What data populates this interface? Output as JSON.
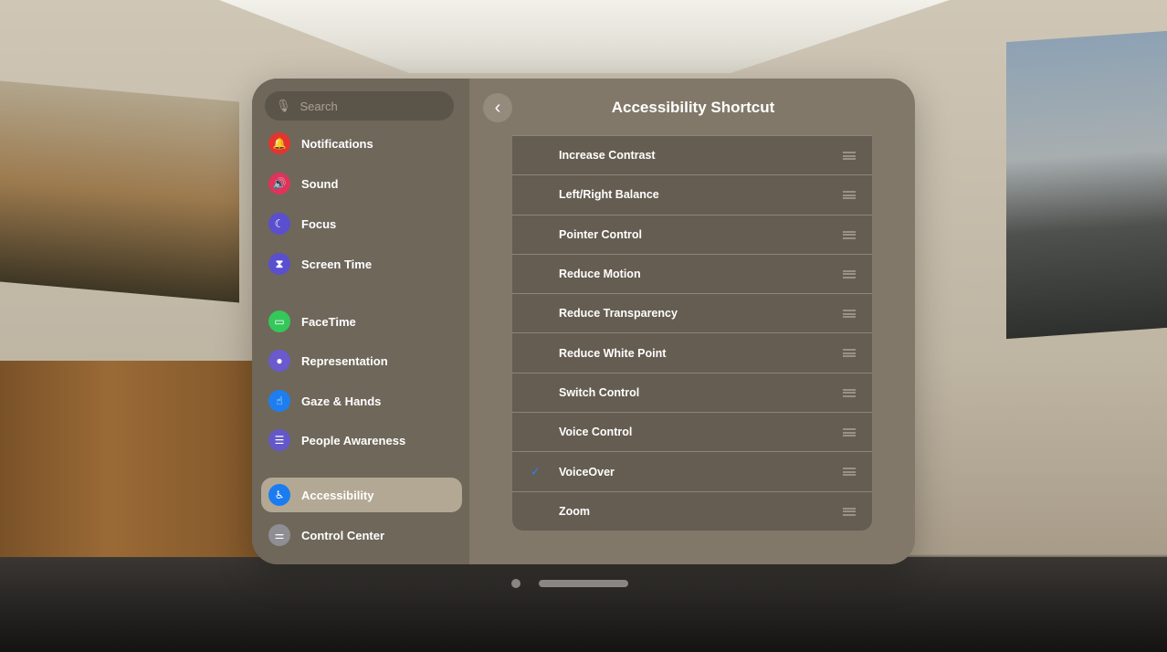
{
  "sidebar": {
    "search_placeholder": "Search",
    "items": [
      {
        "label": "Notifications",
        "icon": "bell-icon",
        "color": "#e5342f"
      },
      {
        "label": "Sound",
        "icon": "speaker-icon",
        "color": "#e0335a"
      },
      {
        "label": "Focus",
        "icon": "moon-icon",
        "color": "#5a4fcf"
      },
      {
        "label": "Screen Time",
        "icon": "hourglass-icon",
        "color": "#5a4fcf"
      },
      {
        "label": "FaceTime",
        "icon": "video-icon",
        "color": "#34c759"
      },
      {
        "label": "Representation",
        "icon": "person-icon",
        "color": "#6a5acd"
      },
      {
        "label": "Gaze & Hands",
        "icon": "hand-icon",
        "color": "#1e7ef0"
      },
      {
        "label": "People Awareness",
        "icon": "people-awareness-icon",
        "color": "#6357c9"
      },
      {
        "label": "Accessibility",
        "icon": "accessibility-icon",
        "color": "#1a7cf0",
        "selected": true
      },
      {
        "label": "Control Center",
        "icon": "toggles-icon",
        "color": "#8e8e93"
      }
    ]
  },
  "detail": {
    "title": "Accessibility Shortcut",
    "items": [
      {
        "label": "Increase Contrast",
        "checked": false
      },
      {
        "label": "Left/Right Balance",
        "checked": false
      },
      {
        "label": "Pointer Control",
        "checked": false
      },
      {
        "label": "Reduce Motion",
        "checked": false
      },
      {
        "label": "Reduce Transparency",
        "checked": false
      },
      {
        "label": "Reduce White Point",
        "checked": false
      },
      {
        "label": "Switch Control",
        "checked": false
      },
      {
        "label": "Voice Control",
        "checked": false
      },
      {
        "label": "VoiceOver",
        "checked": true
      },
      {
        "label": "Zoom",
        "checked": false
      }
    ]
  }
}
